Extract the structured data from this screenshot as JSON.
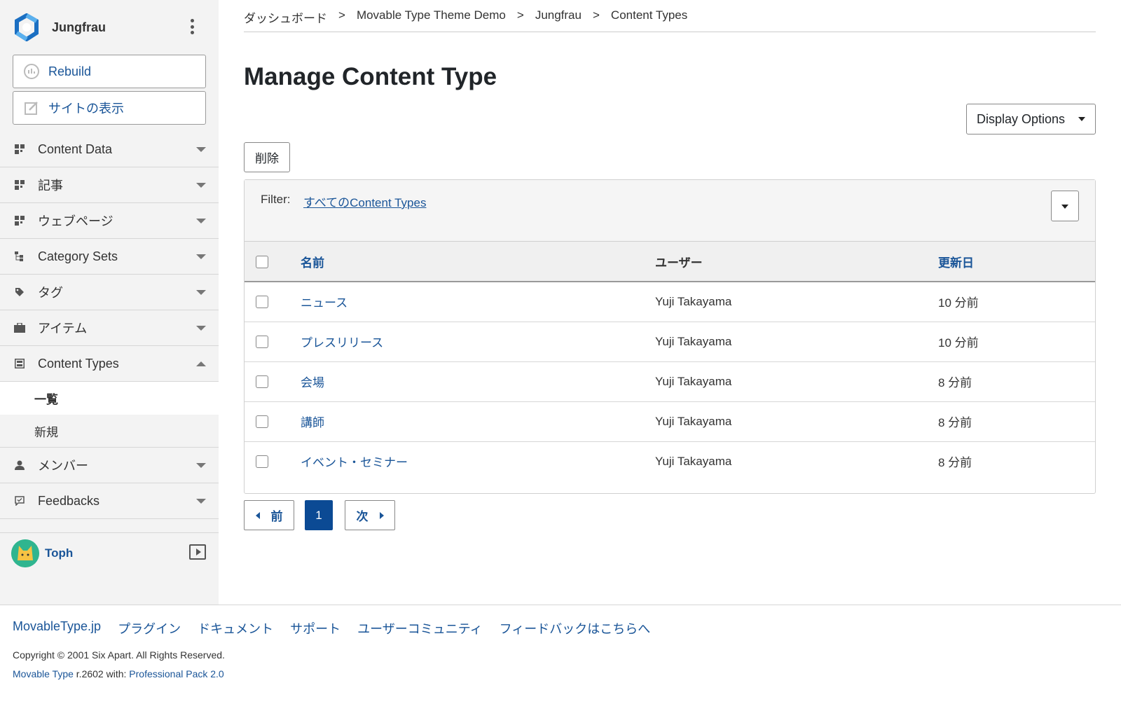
{
  "site": {
    "name": "Jungfrau"
  },
  "sidebar": {
    "rebuild_label": "Rebuild",
    "view_site_label": "サイトの表示",
    "menu": [
      {
        "label": "Content Data",
        "icon": "content-data-icon"
      },
      {
        "label": "記事",
        "icon": "entries-icon"
      },
      {
        "label": "ウェブページ",
        "icon": "webpages-icon"
      },
      {
        "label": "Category Sets",
        "icon": "category-tree-icon"
      },
      {
        "label": "タグ",
        "icon": "tag-icon"
      },
      {
        "label": "アイテム",
        "icon": "folder-icon"
      },
      {
        "label": "Content Types",
        "icon": "content-types-icon",
        "expanded": true
      }
    ],
    "submenu": {
      "list": "一覧",
      "new": "新規"
    },
    "menu_after": [
      {
        "label": "メンバー",
        "icon": "user-icon"
      },
      {
        "label": "Feedbacks",
        "icon": "feedback-icon"
      }
    ],
    "user": {
      "name": "Toph"
    }
  },
  "breadcrumb": [
    "ダッシュボード",
    "Movable Type Theme Demo",
    "Jungfrau",
    "Content Types"
  ],
  "breadcrumb_separator": ">",
  "page": {
    "title": "Manage Content Type",
    "display_options_label": "Display Options",
    "delete_label": "削除",
    "filter_label": "Filter:",
    "filter_value": "すべてのContent Types"
  },
  "table": {
    "headers": {
      "name": "名前",
      "user": "ユーザー",
      "updated": "更新日"
    },
    "rows": [
      {
        "name": "ニュース",
        "user": "Yuji Takayama",
        "updated": "10 分前"
      },
      {
        "name": "プレスリリース",
        "user": "Yuji Takayama",
        "updated": "10 分前"
      },
      {
        "name": "会場",
        "user": "Yuji Takayama",
        "updated": "8 分前"
      },
      {
        "name": "講師",
        "user": "Yuji Takayama",
        "updated": "8 分前"
      },
      {
        "name": "イベント・セミナー",
        "user": "Yuji Takayama",
        "updated": "8 分前"
      }
    ]
  },
  "pager": {
    "prev": "前",
    "current": "1",
    "next": "次"
  },
  "footer": {
    "links": [
      "MovableType.jp",
      "プラグイン",
      "ドキュメント",
      "サポート",
      "ユーザーコミュニティ",
      "フィードバックはこちらへ"
    ],
    "copyright": "Copyright © 2001 Six Apart. All Rights Reserved.",
    "version_product": "Movable Type",
    "version_text": " r.2602 with: ",
    "version_pack": "Professional Pack 2.0"
  },
  "colors": {
    "link": "#1a5598",
    "sidebar_bg": "#f3f3f3",
    "current_page": "#0b4a94"
  }
}
